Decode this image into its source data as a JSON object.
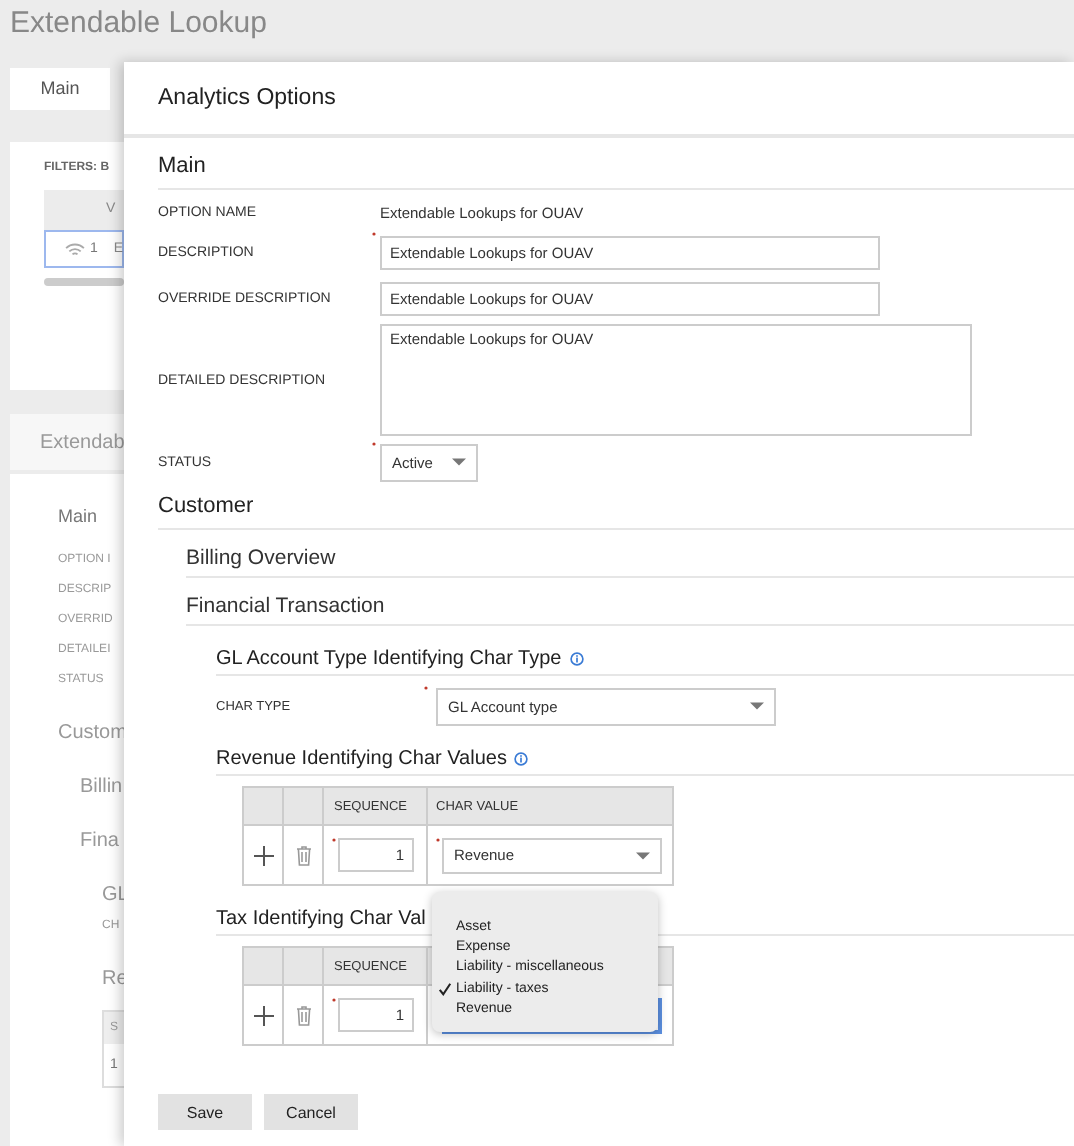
{
  "page": {
    "title": "Extendable Lookup",
    "tabs": [
      {
        "label": "Main",
        "selected": true
      }
    ],
    "filters_label": "FILTERS: B",
    "grid": {
      "column_1": "V",
      "rows": [
        {
          "number": "1",
          "column_1": "E",
          "selected": true
        }
      ]
    },
    "section_title": "Extendab",
    "section": {
      "heading": "Main",
      "labels": [
        "OPTION I",
        "DESCRIP",
        "OVERRID",
        "DETAILEI",
        "STATUS"
      ],
      "customer": "Custom",
      "billing": "Billin",
      "financial": "Fina",
      "gl": "GL",
      "char_type": "CH",
      "revenue": "Re",
      "table": {
        "column_1": "S",
        "row": "1"
      }
    }
  },
  "dialog": {
    "title": "Analytics Options",
    "main": {
      "heading": "Main",
      "fields": [
        {
          "kind": "text",
          "label": "OPTION NAME",
          "value": "Extendable Lookups for OUAV",
          "required": false
        },
        {
          "kind": "input",
          "label": "DESCRIPTION",
          "value": "Extendable Lookups for OUAV",
          "required": true
        },
        {
          "kind": "input",
          "label": "OVERRIDE DESCRIPTION",
          "value": "Extendable Lookups for OUAV",
          "required": false
        },
        {
          "kind": "textarea",
          "label": "DETAILED DESCRIPTION",
          "value": "Extendable Lookups for OUAV",
          "required": false
        },
        {
          "kind": "select",
          "label": "STATUS",
          "value": "Active",
          "required": true
        }
      ]
    },
    "customer": {
      "heading": "Customer",
      "billing": "Billing Overview",
      "financial": "Financial Transaction",
      "groups": [
        {
          "kind": "field",
          "heading": "GL Account Type Identifying Char Type",
          "info": true,
          "label": "CHAR TYPE",
          "value": "GL Account type",
          "required": true
        },
        {
          "kind": "table",
          "heading": "Revenue Identifying Char Values",
          "info": true,
          "columns": [
            "SEQUENCE",
            "CHAR VALUE"
          ],
          "rows": [
            {
              "sequence": "1",
              "sequence_required": true,
              "char_value": "Revenue",
              "char_value_required": true
            }
          ]
        },
        {
          "kind": "table",
          "heading": "Tax Identifying Char Val",
          "columns": [
            "SEQUENCE"
          ],
          "rows": [
            {
              "sequence": "1",
              "sequence_required": true
            }
          ],
          "dropdown": {
            "options": [
              {
                "label": "Asset",
                "selected": false
              },
              {
                "label": "Expense",
                "selected": false
              },
              {
                "label": "Liability - miscellaneous",
                "selected": false
              },
              {
                "label": "Liability - taxes",
                "selected": true
              },
              {
                "label": "Revenue",
                "selected": false
              }
            ]
          }
        }
      ]
    },
    "buttons": [
      "Save",
      "Cancel"
    ]
  }
}
